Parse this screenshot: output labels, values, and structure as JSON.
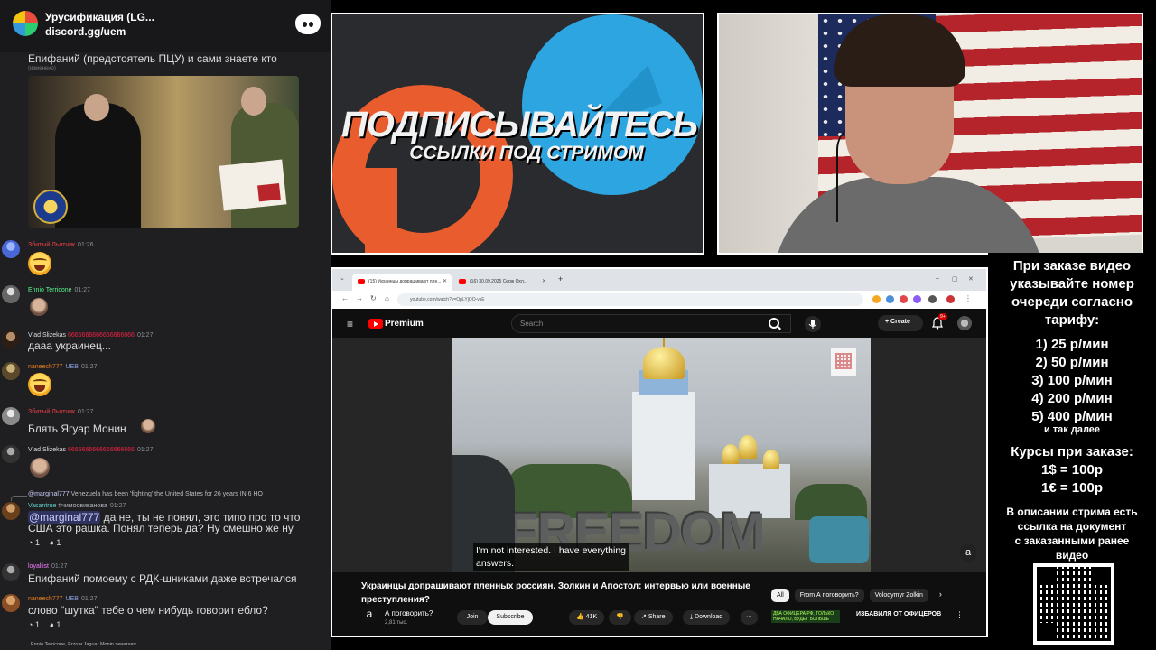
{
  "server": {
    "name": "Урусификация (LG...",
    "invite": "discord.gg/uem"
  },
  "chat": {
    "top_text": "Епифаний (предстоятель ПЦУ) и сами знаете кто",
    "edited_label": "(изменено)",
    "messages": [
      {
        "user": "Збитый Льотчик",
        "time": "01:26"
      },
      {
        "user": "Ennio Terricone",
        "time": "01:27"
      },
      {
        "user": "Vlad Slizekas",
        "extra": "6666666666666666666",
        "time": "01:27",
        "text": "дааа украинец..."
      },
      {
        "user": "naneech777",
        "badge": "UEB",
        "time": "01:27"
      },
      {
        "user": "Збитый Льотчик",
        "time": "01:27",
        "text": "Блять Ягуар Монин"
      },
      {
        "user": "Vlad Slizekas",
        "extra": "6666666666666666666",
        "time": "01:27"
      },
      {
        "user": "Vasantrue",
        "extra": "#чимоовиванова",
        "time": "01:27",
        "reply_user": "@marginal777",
        "reply_text": "Venezuela has been 'fighting' the United States for 26 years IN 6 HO",
        "mention": "@marginal777",
        "text_line1": " да не, ты не понял, это типо про то что",
        "text_line2": "США это рашка. Понял теперь да? Ну смешно же ну",
        "reactions": [
          "1",
          "1"
        ]
      },
      {
        "user": "loyallist",
        "time": "01:27",
        "text": "Епифаний помоему с РДК-шниками даже встречался"
      },
      {
        "user": "naneech777",
        "badge": "UEB",
        "time": "01:27",
        "text": "слово \"шутка\" тебе о чем нибудь говорит ебло?",
        "reactions": [
          "1",
          "1"
        ]
      }
    ],
    "typing": "Ennio Terricone, Erzo и Jaguar Monin печатают..."
  },
  "promo": {
    "title": "ПОДПИСЫВАЙТЕСЬ",
    "subtitle": "ССЫЛКИ ПОД СТРИМОМ"
  },
  "browser": {
    "tabs": [
      "(15) Украинцы допрашивают пле...",
      "(16) 30.09.2025 Серж Охл..."
    ],
    "url": "youtube.com/watch?v=OpLYjOO-vsE",
    "yt_brand": "Premium",
    "search_placeholder": "Search",
    "create_label": "Create",
    "notif_count": "9+",
    "subtitle_line1": "I'm not interested. I have everything",
    "subtitle_line2": "answers.",
    "video_title": "Украинцы допрашивают пленных россиян. Золкин и Апостол: интервью или военные преступления?",
    "channel_name": "А поговорить?",
    "channel_subs": "2,81 тыс.",
    "join_label": "Join",
    "subscribe_label": "Subscribe",
    "likes": "41K",
    "share_label": "Share",
    "download_label": "Download",
    "chips": [
      "All",
      "From А поговорить?",
      "Volodymyr Zolkin"
    ],
    "rec_thumb_text": "ДВА ОФИЦЕРА РФ, ТОЛЬКО НАЧАЛО, БУДЕТ БОЛЬШЕ",
    "rec_title": "ИЗБАВИЛЯ ОТ ОФИЦЕРОВ",
    "freedom_word": "FREEDOM"
  },
  "pricing": {
    "intro": [
      "При заказе видео",
      "указывайте номер",
      "очереди согласно",
      "тарифу:"
    ],
    "tiers": [
      "1) 25 р/мин",
      "2) 50 р/мин",
      "3) 100 р/мин",
      "4) 200 р/мин",
      "5) 400 р/мин"
    ],
    "and_so_on": "и так далее",
    "rates_title": "Курсы при заказе:",
    "rates": [
      "1$ = 100р",
      "1€ = 100р"
    ],
    "description": [
      "В описании стрима есть",
      "ссылка на документ",
      "с заказанными ранее",
      "видео"
    ]
  }
}
